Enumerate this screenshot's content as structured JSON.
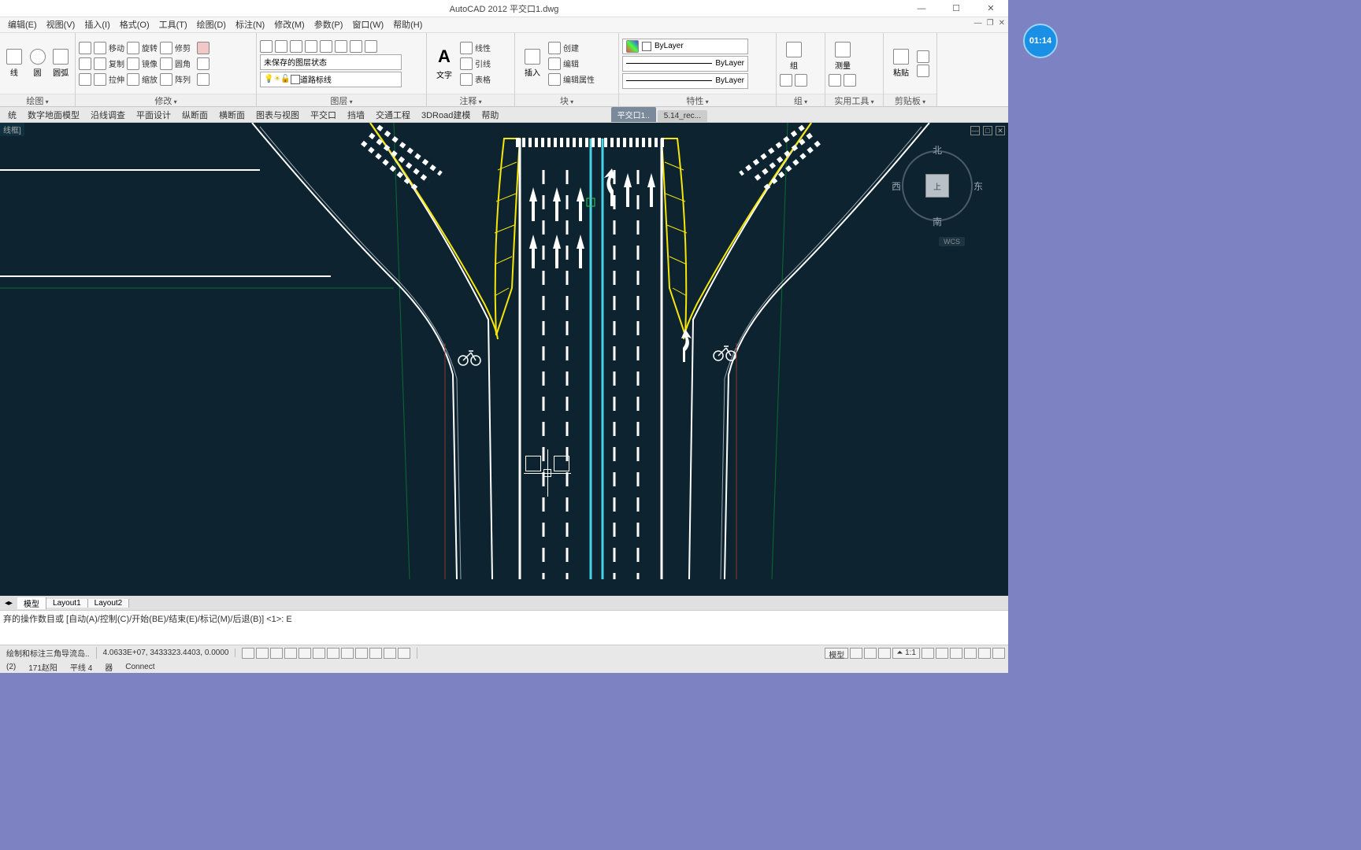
{
  "title": "AutoCAD 2012    平交口1.dwg",
  "menus": [
    "编辑(E)",
    "视图(V)",
    "插入(I)",
    "格式(O)",
    "工具(T)",
    "绘图(D)",
    "标注(N)",
    "修改(M)",
    "参数(P)",
    "窗口(W)",
    "帮助(H)"
  ],
  "ribbon": {
    "draw": {
      "label": "绘图",
      "items": [
        "线",
        "圆",
        "圆弧"
      ]
    },
    "modify": {
      "label": "修改",
      "btns": [
        [
          "移动",
          "旋转",
          "修剪"
        ],
        [
          "复制",
          "镜像",
          "圆角"
        ],
        [
          "拉伸",
          "缩放",
          "阵列"
        ]
      ]
    },
    "layers": {
      "label": "图层",
      "unsaved": "未保存的图层状态",
      "current": "道路标线"
    },
    "annot": {
      "label": "注释",
      "text": "文字",
      "items": [
        [
          "线性"
        ],
        [
          "引线"
        ],
        [
          "表格"
        ]
      ]
    },
    "block": {
      "label": "块",
      "insert": "插入",
      "items": [
        [
          "创建"
        ],
        [
          "编辑"
        ],
        [
          "编辑属性"
        ]
      ]
    },
    "props": {
      "label": "特性",
      "bylayer": "ByLayer"
    },
    "group": {
      "label": "组",
      "text": "组"
    },
    "util": {
      "label": "实用工具",
      "text": "测量"
    },
    "clip": {
      "label": "剪贴板",
      "text": "粘贴"
    }
  },
  "secmenu": [
    "统",
    "数字地面模型",
    "沿线调查",
    "平面设计",
    "纵断面",
    "横断面",
    "图表与视图",
    "平交口",
    "挡墙",
    "交通工程",
    "3DRoad建模",
    "帮助"
  ],
  "doctabs": [
    {
      "name": "平交口1..",
      "active": true
    },
    {
      "name": "5.14_rec...",
      "active": false
    }
  ],
  "canvas_label": "线框]",
  "compass": {
    "n": "北",
    "s": "南",
    "e": "东",
    "w": "西",
    "top": "上"
  },
  "wcs": "WCS",
  "layouts": [
    "模型",
    "Layout1",
    "Layout2"
  ],
  "cmd": "弃的操作数目或 [自动(A)/控制(C)/开始(BE)/结束(E)/标记(M)/后退(B)] <1>:  E",
  "status": {
    "hint": "绘制和标注三角导流岛..",
    "coords": "4.0633E+07, 3433323.4403, 0.0000",
    "line2_a": "(2)",
    "line2_b": "171赵阳",
    "line2_c": "平线 4",
    "line2_d": "器",
    "line2_e": "Connect",
    "right_label": "模型",
    "scale": "1:1"
  },
  "clock": "01:14"
}
